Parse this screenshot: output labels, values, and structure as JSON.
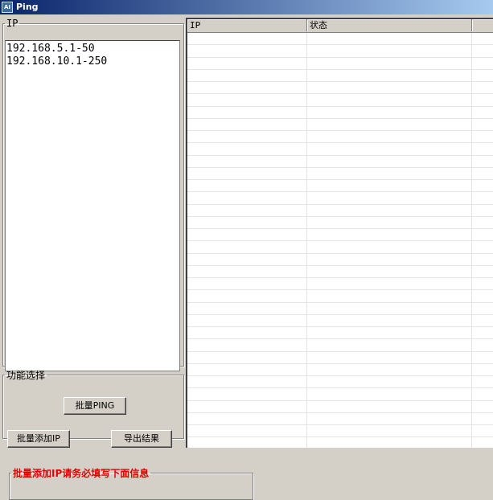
{
  "window": {
    "title": "Ping",
    "icon": "app-icon"
  },
  "ip_panel": {
    "legend": "IP",
    "entries": [
      "192.168.5.1-50",
      "192.168.10.1-250"
    ]
  },
  "function_panel": {
    "legend": "功能选择",
    "batch_ping_label": "批量PING",
    "batch_add_ip_label": "批量添加IP",
    "export_results_label": "导出结果"
  },
  "results_table": {
    "columns": [
      "IP",
      "状态",
      ""
    ],
    "rows": []
  },
  "batch_add_panel": {
    "legend": "批量添加IP请务必填写下面信息"
  },
  "colors": {
    "window_bg": "#d4d0c8",
    "titlebar": "#0a246a",
    "warning_text": "#e00000"
  }
}
